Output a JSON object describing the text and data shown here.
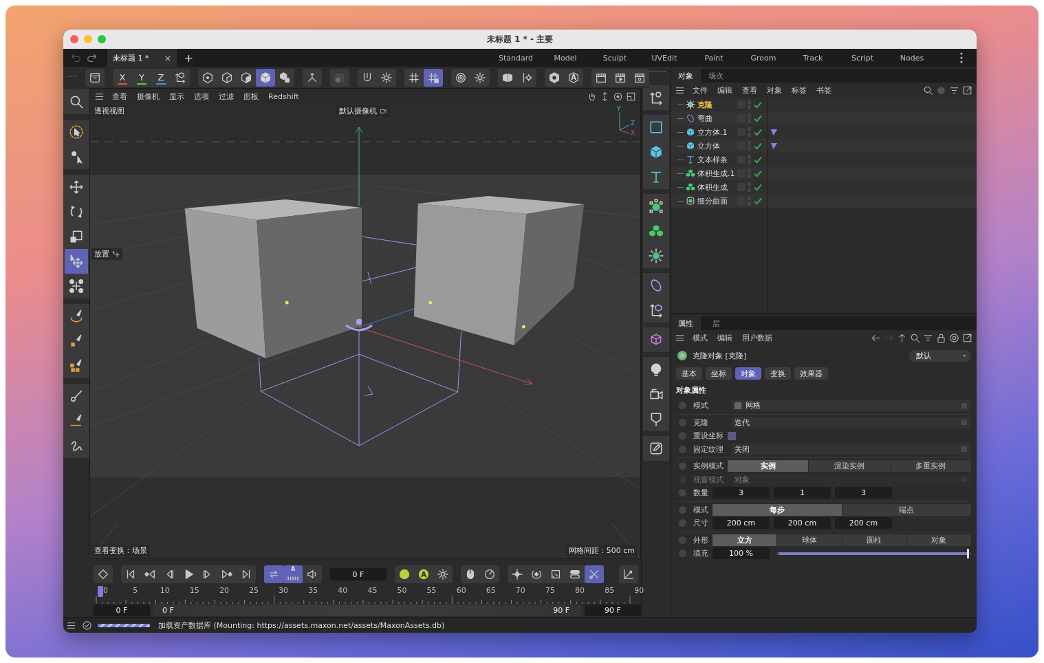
{
  "window": {
    "title": "未标题 1 * - 主要"
  },
  "doc_tabs": [
    {
      "label": "未标题 1 *",
      "selected": true,
      "close": "×"
    }
  ],
  "new_tab": "+",
  "layouts": [
    "Standard",
    "Model",
    "Sculpt",
    "UVEdit",
    "Paint",
    "Groom",
    "Track",
    "Script",
    "Nodes"
  ],
  "main_toolbar": [
    {
      "selected": false
    },
    {
      "label": "X",
      "color": "#d9534f",
      "selected": false
    },
    {
      "label": "Y",
      "color": "#6cc04a",
      "selected": false
    },
    {
      "label": "Z",
      "color": "#4a8fd9",
      "selected": false
    },
    {
      "selected": false
    },
    {
      "selected": false
    },
    {
      "selected": false
    },
    {
      "selected": false
    },
    {
      "selected": true
    },
    {
      "selected": false
    },
    {
      "selected": false
    },
    {
      "selected": false
    },
    {
      "selected": false
    },
    {
      "selected": false
    },
    {
      "selected": false
    },
    {
      "selected": true
    },
    {
      "selected": false
    },
    {
      "selected": false
    },
    {
      "selected": false
    },
    {
      "selected": false
    },
    {
      "selected": false
    },
    {
      "label": "A",
      "selected": false
    },
    {
      "selected": false
    },
    {
      "selected": false
    },
    {
      "selected": false
    }
  ],
  "left_tools": [
    {
      "selected": false
    },
    {
      "selected": false
    },
    {
      "selected": false
    },
    {
      "selected": false
    },
    {
      "selected": false
    },
    {
      "selected": false
    },
    {
      "selected": true
    },
    {
      "selected": false
    },
    {
      "selected": false
    },
    {
      "selected": false
    },
    {
      "selected": false
    },
    {
      "selected": false
    },
    {
      "selected": false
    },
    {
      "selected": false
    }
  ],
  "right_tools": [
    {
      "selected": false
    },
    {
      "selected": false
    },
    {
      "selected": false
    },
    {
      "selected": false
    },
    {
      "selected": false
    },
    {
      "selected": false
    },
    {
      "selected": false
    },
    {
      "selected": false
    },
    {
      "selected": false
    },
    {
      "selected": false
    },
    {
      "selected": false
    },
    {
      "selected": false
    },
    {
      "selected": false
    },
    {
      "selected": false
    }
  ],
  "viewport": {
    "menu": [
      "查看",
      "摄像机",
      "显示",
      "选项",
      "过滤",
      "面板",
      "Redshift"
    ],
    "view_name": "透视视图",
    "camera": "默认摄像机",
    "axis_labels": [
      "Y",
      "Z",
      "X"
    ],
    "tool_hint": "放置",
    "transform_info": "查看变换：场景",
    "grid_info": "网格间距 : 500 cm"
  },
  "timeline": {
    "controls": [
      {
        "selected": false
      },
      {
        "selected": false
      },
      {
        "selected": false
      },
      {
        "selected": false
      },
      {
        "selected": false
      },
      {
        "selected": false
      },
      {
        "selected": false
      },
      {
        "selected": false
      },
      {
        "selected": true
      },
      {
        "label": "A",
        "selected": true
      },
      {
        "selected": false
      },
      {
        "selected": false
      },
      {
        "label": "A",
        "selected": false
      },
      {
        "selected": false
      },
      {
        "selected": false
      },
      {
        "selected": false
      },
      {
        "selected": false
      },
      {
        "selected": false
      },
      {
        "selected": false
      },
      {
        "selected": false
      },
      {
        "selected": true
      },
      {
        "selected": false
      }
    ],
    "frame": "0 F",
    "ruler": [
      "0",
      "5",
      "10",
      "15",
      "20",
      "25",
      "30",
      "35",
      "40",
      "45",
      "50",
      "55",
      "60",
      "65",
      "70",
      "75",
      "80",
      "85",
      "90"
    ],
    "playhead": {
      "level": 0
    },
    "range_start": "0 F",
    "range_slider": {
      "level": 1
    },
    "slider_start": "0 F",
    "slider_end": "90 F",
    "range_end": "90 F"
  },
  "object_manager": {
    "tabs": [
      {
        "label": "对象",
        "selected": true
      },
      {
        "label": "场次",
        "selected": false
      }
    ],
    "menu": [
      "文件",
      "编辑",
      "查看",
      "对象",
      "标签",
      "书签"
    ],
    "objects": [
      {
        "name": "克隆",
        "kind": "cloner",
        "selected": true,
        "tagged": false
      },
      {
        "name": "弯曲",
        "kind": "bend",
        "selected": false,
        "tagged": false
      },
      {
        "name": "立方体.1",
        "kind": "cube",
        "selected": false,
        "tagged": true
      },
      {
        "name": "立方体",
        "kind": "cube",
        "selected": false,
        "tagged": true
      },
      {
        "name": "文本样条",
        "kind": "text",
        "selected": false,
        "tagged": false
      },
      {
        "name": "体积生成.1",
        "kind": "volume",
        "selected": false,
        "tagged": false
      },
      {
        "name": "体积生成",
        "kind": "volume",
        "selected": false,
        "tagged": false
      },
      {
        "name": "细分曲面",
        "kind": "subdivision",
        "selected": false,
        "tagged": false
      }
    ]
  },
  "attributes": {
    "tabs": [
      {
        "label": "属性",
        "selected": true
      },
      {
        "label": "层",
        "selected": false
      }
    ],
    "menu": [
      "模式",
      "编辑",
      "用户数据"
    ],
    "object_title": "克隆对象 [克隆]",
    "preset": "默认",
    "pages": [
      {
        "label": "基本",
        "selected": false
      },
      {
        "label": "坐标",
        "selected": false
      },
      {
        "label": "对象",
        "selected": true
      },
      {
        "label": "变换",
        "selected": false
      },
      {
        "label": "效果器",
        "selected": false
      }
    ],
    "section": "对象属性",
    "groups": [
      {
        "rows": [
          {
            "kind": "dropdown",
            "label": "模式",
            "value": "网格",
            "has_icon": true,
            "disabled": false
          }
        ]
      },
      {
        "rows": [
          {
            "kind": "dropdown",
            "label": "克隆",
            "value": "迭代",
            "has_icon": false,
            "disabled": false
          },
          {
            "kind": "checkbox",
            "label": "重设坐标",
            "checked": false
          },
          {
            "kind": "dropdown",
            "label": "固定纹理",
            "value": "关闭",
            "has_icon": false,
            "disabled": false
          }
        ]
      },
      {
        "rows": [
          {
            "kind": "segmented",
            "label": "实例模式",
            "options": [
              {
                "label": "实例",
                "selected": true
              },
              {
                "label": "渲染实例",
                "selected": false
              },
              {
                "label": "多重实例",
                "selected": false
              }
            ]
          },
          {
            "kind": "dropdown",
            "label": "视窗模式",
            "value": "对象",
            "has_icon": false,
            "disabled": true
          },
          {
            "kind": "numbers",
            "label": "数量",
            "values": [
              "3",
              "1",
              "3"
            ]
          }
        ]
      },
      {
        "rows": [
          {
            "kind": "segmented",
            "label": "模式",
            "options": [
              {
                "label": "每步",
                "selected": true
              },
              {
                "label": "端点",
                "selected": false
              }
            ]
          },
          {
            "kind": "numbers",
            "label": "尺寸",
            "values": [
              "200 cm",
              "200 cm",
              "200 cm"
            ]
          }
        ]
      },
      {
        "rows": [
          {
            "kind": "segmented",
            "label": "外形",
            "options": [
              {
                "label": "立方",
                "selected": true
              },
              {
                "label": "球体",
                "selected": false
              },
              {
                "label": "圆柱",
                "selected": false
              },
              {
                "label": "对象",
                "selected": false
              }
            ]
          },
          {
            "kind": "slider",
            "label": "填充",
            "value": "100 %",
            "level": 1
          }
        ]
      }
    ]
  },
  "status": {
    "text": "加载资产数据库 (Mounting: https://assets.maxon.net/assets/MaxonAssets.db)"
  }
}
